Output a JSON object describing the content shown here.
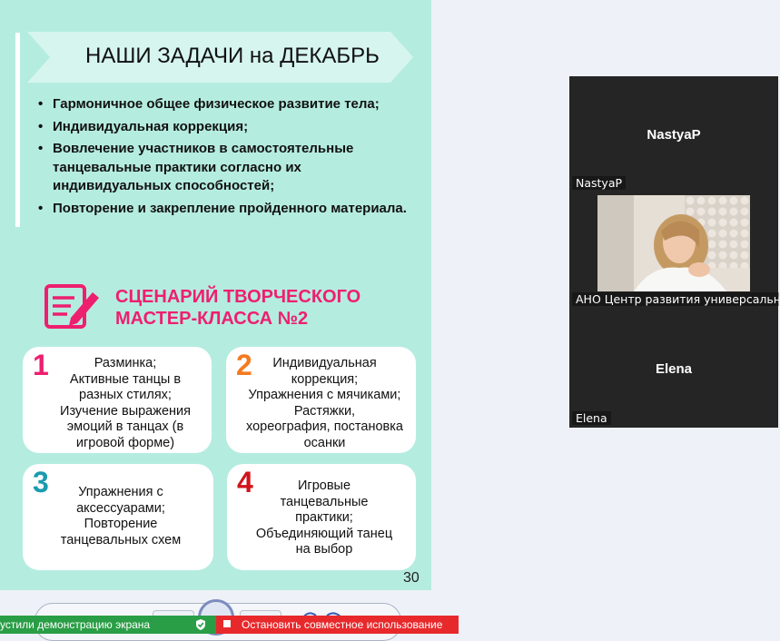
{
  "slide": {
    "title": "НАШИ ЗАДАЧИ на ДЕКАБРЬ",
    "bullets": [
      "Гармоничное общее физическое развитие тела;",
      "Индивидуальная коррекция;",
      "Вовлечение участников в самостоятельные танцевальные практики согласно их индивидуальных способностей;",
      "Повторение и закрепление пройденного материала."
    ],
    "script_title": "СЦЕНАРИЙ ТВОРЧЕСКОГО\nМАСТЕР-КЛАССА №2",
    "cards": [
      {
        "num": "1",
        "color": "#ee1f6f",
        "text": "Разминка;\nАктивные танцы в\nразных стилях;\nИзучение выражения\nэмоций в танцах (в\nигровой форме)"
      },
      {
        "num": "2",
        "color": "#f47a20",
        "text": "Индивидуальная\nкоррекция;\nУпражнения с мячиками;\nРастяжки,\nхореография, постановка\nосанки"
      },
      {
        "num": "3",
        "color": "#1a9bb0",
        "text": "Упражнения с\nаксессуарами;\nПовторение\nтанцевальных схем"
      },
      {
        "num": "4",
        "color": "#d0141c",
        "text": "Игровые\nтанцевальные\nпрактики;\nОбъединяющий танец\nна выбор"
      }
    ],
    "page_number": "30"
  },
  "participants": [
    {
      "center_name": "NastyaP",
      "label": "NastyaP",
      "video": false
    },
    {
      "center_name": "",
      "label": "АНО Центр развития универсальн...",
      "video": true
    },
    {
      "center_name": "Elena",
      "label": "Elena",
      "video": false
    }
  ],
  "status": {
    "sharing_text": "устили демонстрацию экрана",
    "stop_sharing_label": "Остановить совместное использование"
  },
  "colors": {
    "slide_bg": "#b5ece0",
    "accent_pink": "#ee1f6f",
    "tile_bg": "#252525",
    "status_green": "#2a9e46",
    "status_red": "#e8292c"
  }
}
